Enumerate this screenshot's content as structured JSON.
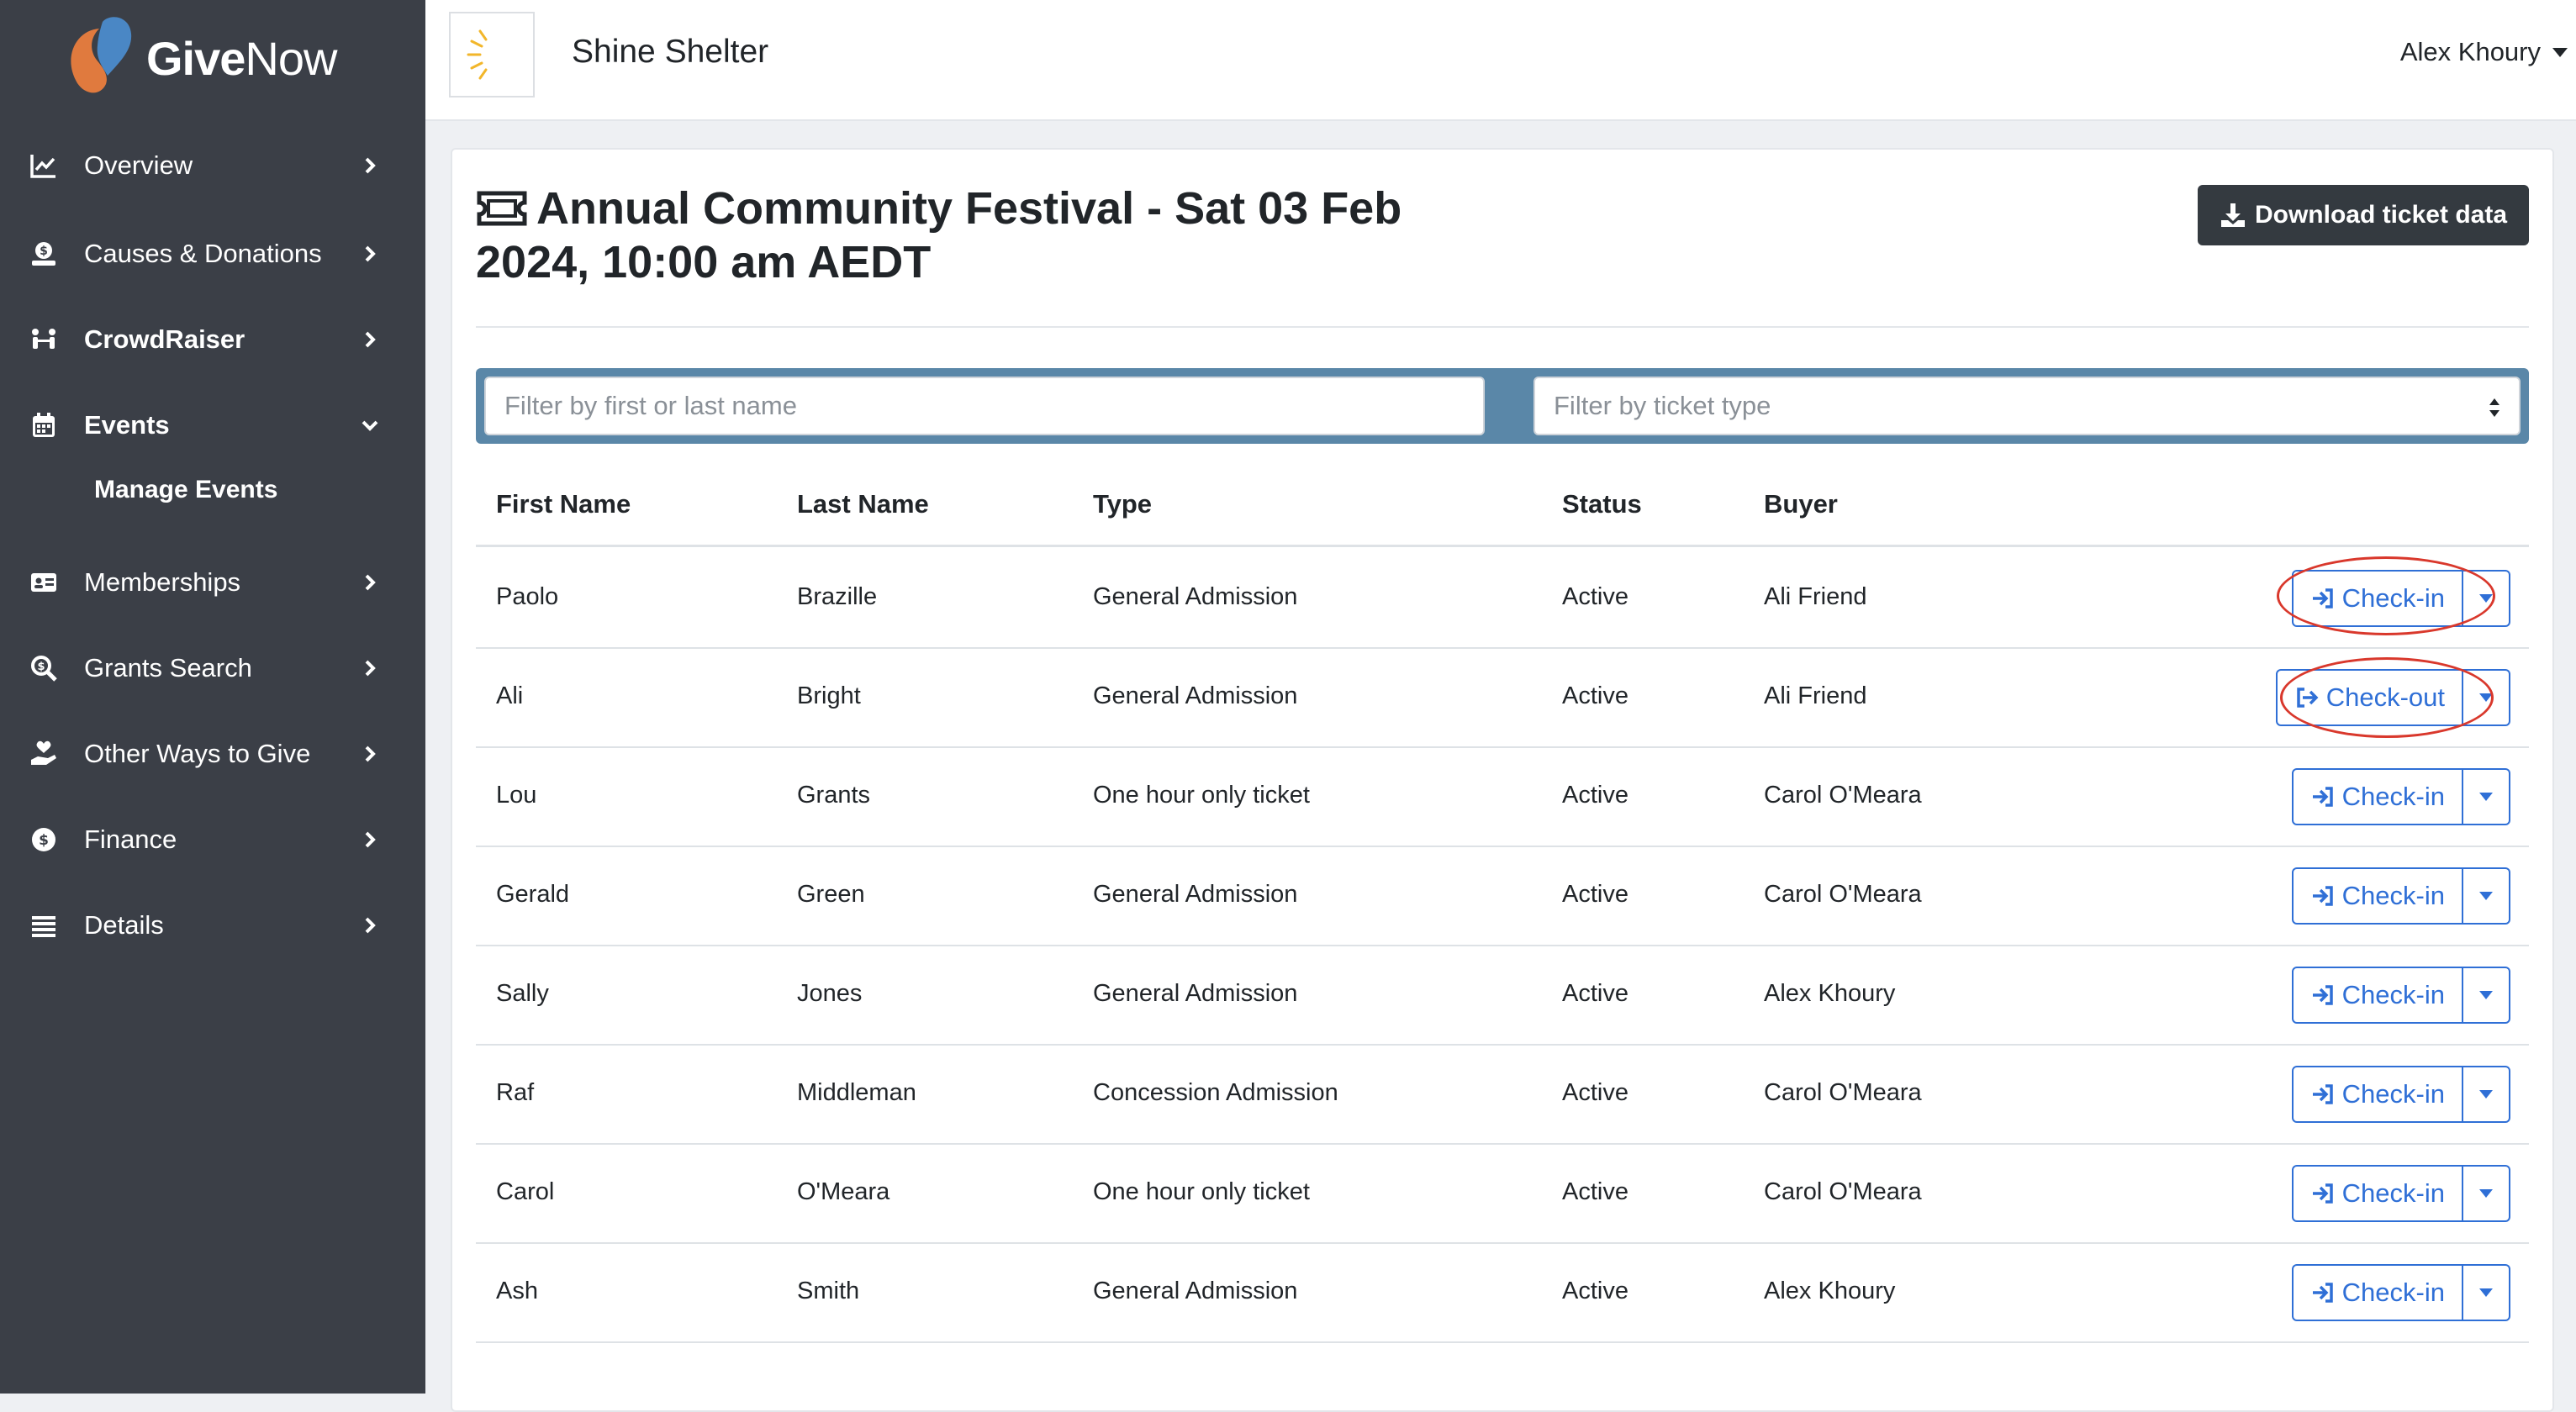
{
  "brand": {
    "logo_text_bold": "Give",
    "logo_text_light": "Now"
  },
  "sidebar": {
    "items": [
      {
        "label": "Overview",
        "icon": "chart-line-icon"
      },
      {
        "label": "Causes & Donations",
        "icon": "donation-icon"
      },
      {
        "label": "CrowdRaiser",
        "icon": "people-icon"
      },
      {
        "label": "Events",
        "icon": "calendar-icon"
      },
      {
        "label": "Memberships",
        "icon": "id-card-icon"
      },
      {
        "label": "Grants Search",
        "icon": "search-dollar-icon"
      },
      {
        "label": "Other Ways to Give",
        "icon": "hand-heart-icon"
      },
      {
        "label": "Finance",
        "icon": "dollar-circle-icon"
      },
      {
        "label": "Details",
        "icon": "list-icon"
      }
    ],
    "sub_item": "Manage Events"
  },
  "header": {
    "org_name": "Shine Shelter",
    "user_name": "Alex Khoury"
  },
  "event": {
    "title": "Annual Community Festival - Sat 03 Feb 2024, 10:00 am AEDT",
    "download_label": "Download ticket data"
  },
  "filters": {
    "name_placeholder": "Filter by first or last name",
    "type_placeholder": "Filter by ticket type"
  },
  "table": {
    "headers": [
      "First Name",
      "Last Name",
      "Type",
      "Status",
      "Buyer"
    ],
    "rows": [
      {
        "first": "Paolo",
        "last": "Brazille",
        "type": "General Admission",
        "status": "Active",
        "buyer": "Ali Friend",
        "action": "Check-in"
      },
      {
        "first": "Ali",
        "last": "Bright",
        "type": "General Admission",
        "status": "Active",
        "buyer": "Ali Friend",
        "action": "Check-out"
      },
      {
        "first": "Lou",
        "last": "Grants",
        "type": "One hour only ticket",
        "status": "Active",
        "buyer": "Carol O'Meara",
        "action": "Check-in"
      },
      {
        "first": "Gerald",
        "last": "Green",
        "type": "General Admission",
        "status": "Active",
        "buyer": "Carol O'Meara",
        "action": "Check-in"
      },
      {
        "first": "Sally",
        "last": "Jones",
        "type": "General Admission",
        "status": "Active",
        "buyer": "Alex Khoury",
        "action": "Check-in"
      },
      {
        "first": "Raf",
        "last": "Middleman",
        "type": "Concession Admission",
        "status": "Active",
        "buyer": "Carol O'Meara",
        "action": "Check-in"
      },
      {
        "first": "Carol",
        "last": "O'Meara",
        "type": "One hour only ticket",
        "status": "Active",
        "buyer": "Carol O'Meara",
        "action": "Check-in"
      },
      {
        "first": "Ash",
        "last": "Smith",
        "type": "General Admission",
        "status": "Active",
        "buyer": "Alex Khoury",
        "action": "Check-in"
      }
    ]
  },
  "colors": {
    "sidebar": "#3b3f47",
    "accent": "#2f6fd6",
    "annotation": "#d9382c",
    "filter_bar": "#5a87a8",
    "dark_button": "#343a40"
  }
}
